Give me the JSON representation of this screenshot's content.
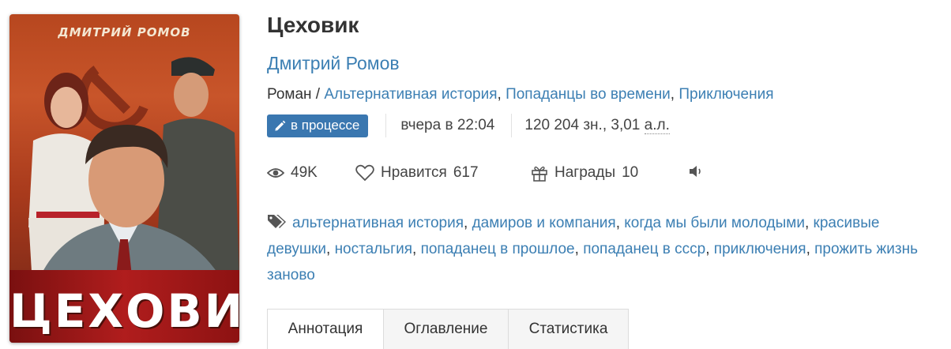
{
  "cover": {
    "author_text": "ДМИТРИЙ РОМОВ",
    "title_text": "ЦЕХОВИК"
  },
  "book": {
    "title": "Цеховик",
    "author": "Дмитрий Ромов",
    "genre_prefix": "Роман / ",
    "genres": [
      "Альтернативная история",
      "Попаданцы во времени",
      "Приключения"
    ],
    "status": "в процессе",
    "updated": "вчера в 22:04",
    "size_chars": "120 204 зн., 3,01",
    "size_unit": "а.л."
  },
  "stats": {
    "views": "49K",
    "likes_label": "Нравится",
    "likes": "617",
    "awards_label": "Награды",
    "awards": "10"
  },
  "tags": [
    "альтернативная история",
    "дамиров и компания",
    "когда мы были молодыми",
    "красивые девушки",
    "ностальгия",
    "попаданец в прошлое",
    "попаданец в ссср",
    "приключения",
    "прожить жизнь заново"
  ],
  "tabs": [
    "Аннотация",
    "Оглавление",
    "Статистика"
  ],
  "colors": {
    "link": "#3c7fb3",
    "badge": "#3a77b0",
    "cover_red": "#b01d1d"
  }
}
